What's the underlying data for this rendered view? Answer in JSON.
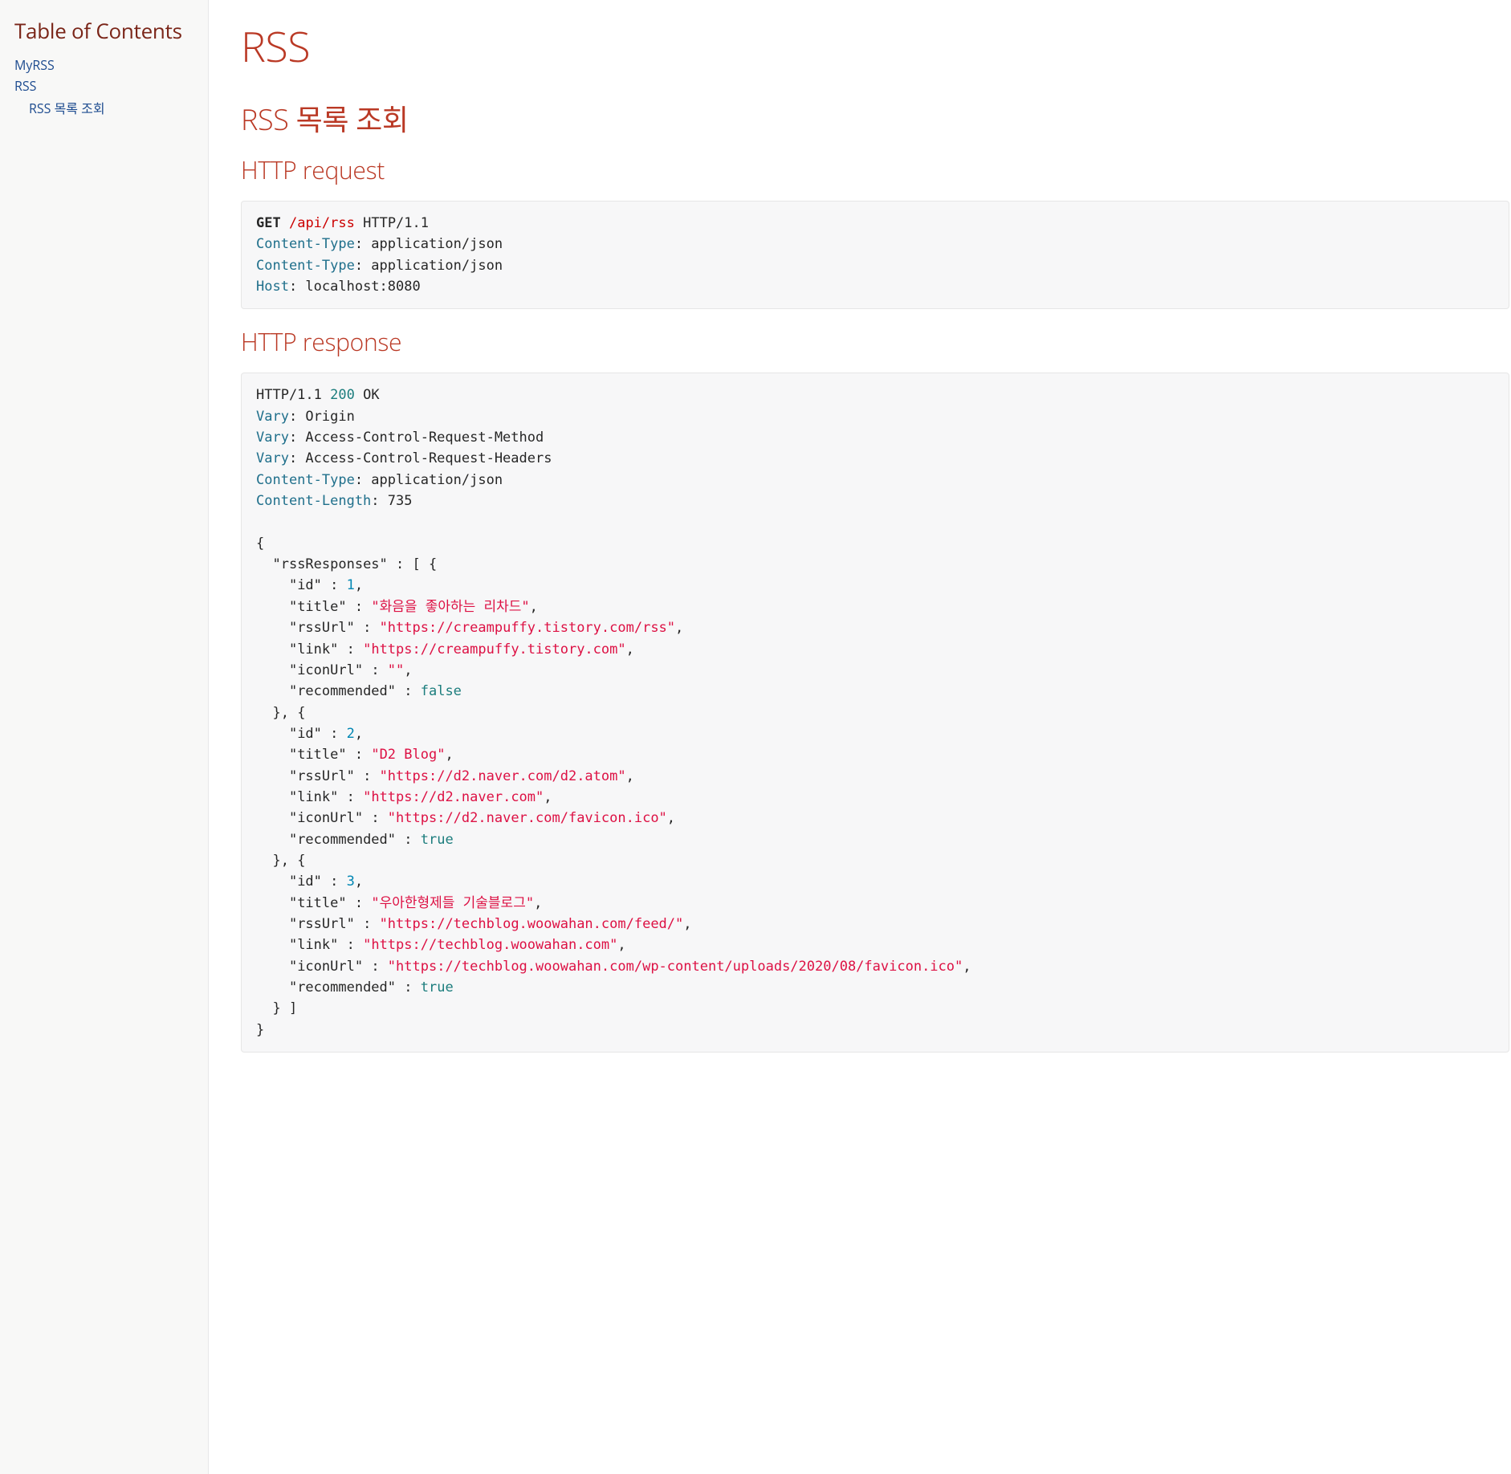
{
  "toc": {
    "title": "Table of Contents",
    "items": [
      {
        "label": "MyRSS",
        "level": 1
      },
      {
        "label": "RSS",
        "level": 1
      },
      {
        "label": "RSS 목록 조회",
        "level": 2
      }
    ]
  },
  "page": {
    "title": "RSS",
    "section_title": "RSS 목록 조회",
    "request_heading": "HTTP request",
    "response_heading": "HTTP response"
  },
  "request": {
    "method": "GET",
    "path": "/api/rss",
    "protocol": "HTTP/1.1",
    "headers": [
      {
        "name": "Content-Type",
        "value": "application/json"
      },
      {
        "name": "Content-Type",
        "value": "application/json"
      },
      {
        "name": "Host",
        "value": "localhost:8080"
      }
    ]
  },
  "response": {
    "protocol": "HTTP/1.1",
    "status_code": "200",
    "status_text": "OK",
    "headers": [
      {
        "name": "Vary",
        "value": "Origin"
      },
      {
        "name": "Vary",
        "value": "Access-Control-Request-Method"
      },
      {
        "name": "Vary",
        "value": "Access-Control-Request-Headers"
      },
      {
        "name": "Content-Type",
        "value": "application/json"
      },
      {
        "name": "Content-Length",
        "value": "735"
      }
    ],
    "body": {
      "rssResponses": [
        {
          "id": 1,
          "title": "화음을 좋아하는 리차드",
          "rssUrl": "https://creampuffy.tistory.com/rss",
          "link": "https://creampuffy.tistory.com",
          "iconUrl": "",
          "recommended": false
        },
        {
          "id": 2,
          "title": "D2 Blog",
          "rssUrl": "https://d2.naver.com/d2.atom",
          "link": "https://d2.naver.com",
          "iconUrl": "https://d2.naver.com/favicon.ico",
          "recommended": true
        },
        {
          "id": 3,
          "title": "우아한형제들 기술블로그",
          "rssUrl": "https://techblog.woowahan.com/feed/",
          "link": "https://techblog.woowahan.com",
          "iconUrl": "https://techblog.woowahan.com/wp-content/uploads/2020/08/favicon.ico",
          "recommended": true
        }
      ]
    }
  }
}
